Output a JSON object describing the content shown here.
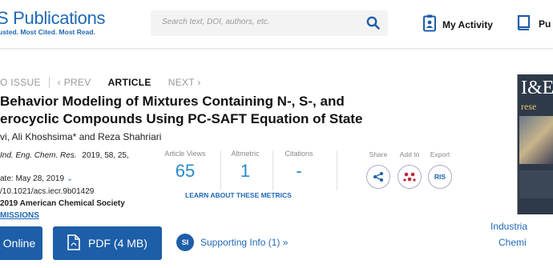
{
  "header": {
    "logo_text": "S Publications",
    "logo_tagline": "usted. Most Cited. Most Read.",
    "search_placeholder": "Search text, DOI, authors, etc.",
    "my_activity": "My Activity",
    "pub_partial": "Pu"
  },
  "breadcrumb": {
    "issue": "O ISSUE",
    "prev": "‹ PREV",
    "article": "ARTICLE",
    "next": "NEXT ›"
  },
  "article": {
    "title_line1": "Behavior Modeling of Mixtures Containing N-, S-, and",
    "title_line2": "erocyclic Compounds Using PC-SAFT Equation of State",
    "authors": "vi, Ali Khoshsima* and Reza Shahriari",
    "journal": "Ind. Eng. Chem. Res.",
    "citation_rest": "2019, 58, 25,",
    "pub_date": "ate: May 28, 2019",
    "doi": "/10.1021/acs.iecr.9b01429",
    "copyright": "2019 American Chemical Society",
    "permissions": "MISSIONS"
  },
  "metrics": {
    "views_label": "Article Views",
    "views_value": "65",
    "altmetric_label": "Altmetric",
    "altmetric_value": "1",
    "citations_label": "Citations",
    "citations_value": "-",
    "learn_more": "LEARN ABOUT THESE METRICS"
  },
  "actions": {
    "share_label": "Share",
    "addto_label": "Add to",
    "export_label": "Export",
    "export_icon_text": "RIS"
  },
  "buttons": {
    "online": "Online",
    "pdf": "PDF (4 MB)",
    "si_badge": "SI",
    "supporting_info": "Supporting Info (1) »"
  },
  "cover": {
    "caption_line1": "Industria",
    "caption_line2": "Chemi",
    "cover_text1": "I&E",
    "cover_text2": "rese"
  },
  "colors": {
    "brand_blue": "#1f69b4",
    "button_blue": "#1d5ea8",
    "metric_blue": "#2a8ac8",
    "addto_red": "#c0263c"
  }
}
